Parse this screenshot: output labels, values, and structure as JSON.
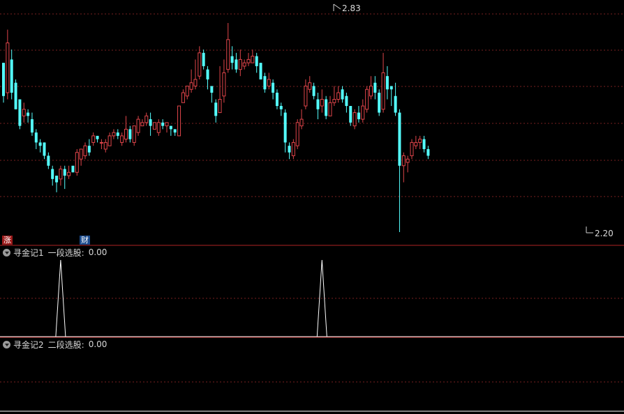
{
  "main_panel": {
    "high_label": "2.83",
    "low_label": "2.20",
    "badge_zhang": "涨",
    "badge_cai": "财",
    "up_color": "#e0454a",
    "down_color": "#54ffff"
  },
  "indicator1": {
    "name": "寻金记1",
    "line_name": "一段选股:",
    "value": "0.00"
  },
  "indicator2": {
    "name": "寻金记2",
    "line_name": "二段选股:",
    "value": "0.00"
  },
  "chart_data": [
    {
      "type": "candlestick",
      "y_min": 2.2,
      "y_max": 2.83,
      "candles": [
        [
          2.71,
          2.61,
          2.71,
          2.59
        ],
        [
          2.62,
          2.77,
          2.81,
          2.6
        ],
        [
          2.72,
          2.62,
          2.75,
          2.6
        ],
        [
          2.65,
          2.57,
          2.66,
          2.57
        ],
        [
          2.6,
          2.52,
          2.6,
          2.51
        ],
        [
          2.55,
          2.57,
          2.59,
          2.53
        ],
        [
          2.56,
          2.55,
          2.57,
          2.53
        ],
        [
          2.54,
          2.5,
          2.56,
          2.49
        ],
        [
          2.5,
          2.47,
          2.51,
          2.45
        ],
        [
          2.47,
          2.46,
          2.48,
          2.44
        ],
        [
          2.47,
          2.43,
          2.47,
          2.42
        ],
        [
          2.43,
          2.4,
          2.44,
          2.39
        ],
        [
          2.39,
          2.36,
          2.4,
          2.34
        ],
        [
          2.37,
          2.35,
          2.37,
          2.32
        ],
        [
          2.36,
          2.39,
          2.4,
          2.34
        ],
        [
          2.39,
          2.37,
          2.4,
          2.33
        ],
        [
          2.37,
          2.38,
          2.4,
          2.36
        ],
        [
          2.4,
          2.38,
          2.39,
          2.38
        ],
        [
          2.38,
          2.44,
          2.45,
          2.37
        ],
        [
          2.42,
          2.45,
          2.45,
          2.4
        ],
        [
          2.43,
          2.46,
          2.47,
          2.42
        ],
        [
          2.46,
          2.44,
          2.48,
          2.43
        ],
        [
          2.47,
          2.49,
          2.5,
          2.46
        ],
        [
          2.49,
          2.48,
          2.49,
          2.47
        ],
        [
          2.47,
          2.47,
          2.48,
          2.45
        ],
        [
          2.45,
          2.47,
          2.48,
          2.44
        ],
        [
          2.46,
          2.49,
          2.5,
          2.46
        ],
        [
          2.49,
          2.5,
          2.51,
          2.48
        ],
        [
          2.5,
          2.49,
          2.51,
          2.48
        ],
        [
          2.47,
          2.49,
          2.5,
          2.46
        ],
        [
          2.48,
          2.51,
          2.55,
          2.47
        ],
        [
          2.51,
          2.48,
          2.52,
          2.47
        ],
        [
          2.47,
          2.52,
          2.52,
          2.46
        ],
        [
          2.5,
          2.54,
          2.55,
          2.49
        ],
        [
          2.52,
          2.53,
          2.54,
          2.52
        ],
        [
          2.53,
          2.55,
          2.56,
          2.52
        ],
        [
          2.54,
          2.52,
          2.56,
          2.49
        ],
        [
          2.51,
          2.53,
          2.53,
          2.51
        ],
        [
          2.5,
          2.53,
          2.54,
          2.49
        ],
        [
          2.53,
          2.52,
          2.54,
          2.51
        ],
        [
          2.52,
          2.53,
          2.53,
          2.5
        ],
        [
          2.52,
          2.51,
          2.52,
          2.49
        ],
        [
          2.51,
          2.5,
          2.51,
          2.49
        ],
        [
          2.49,
          2.58,
          2.58,
          2.49
        ],
        [
          2.59,
          2.62,
          2.63,
          2.59
        ],
        [
          2.61,
          2.64,
          2.64,
          2.6
        ],
        [
          2.63,
          2.65,
          2.69,
          2.62
        ],
        [
          2.64,
          2.66,
          2.72,
          2.63
        ],
        [
          2.67,
          2.74,
          2.76,
          2.66
        ],
        [
          2.74,
          2.7,
          2.75,
          2.69
        ],
        [
          2.69,
          2.66,
          2.7,
          2.63
        ],
        [
          2.64,
          2.62,
          2.64,
          2.59
        ],
        [
          2.59,
          2.55,
          2.6,
          2.53
        ],
        [
          2.56,
          2.6,
          2.7,
          2.56
        ],
        [
          2.61,
          2.68,
          2.72,
          2.59
        ],
        [
          2.69,
          2.78,
          2.83,
          2.68
        ],
        [
          2.73,
          2.71,
          2.76,
          2.69
        ],
        [
          2.72,
          2.69,
          2.74,
          2.68
        ],
        [
          2.69,
          2.72,
          2.75,
          2.67
        ],
        [
          2.7,
          2.71,
          2.72,
          2.69
        ],
        [
          2.71,
          2.72,
          2.74,
          2.7
        ],
        [
          2.71,
          2.73,
          2.75,
          2.71
        ],
        [
          2.73,
          2.7,
          2.74,
          2.68
        ],
        [
          2.71,
          2.66,
          2.71,
          2.66
        ],
        [
          2.67,
          2.63,
          2.68,
          2.62
        ],
        [
          2.64,
          2.66,
          2.68,
          2.63
        ],
        [
          2.65,
          2.62,
          2.66,
          2.6
        ],
        [
          2.62,
          2.58,
          2.63,
          2.57
        ],
        [
          2.58,
          2.57,
          2.59,
          2.55
        ],
        [
          2.56,
          2.47,
          2.57,
          2.44
        ],
        [
          2.46,
          2.44,
          2.47,
          2.42
        ],
        [
          2.43,
          2.47,
          2.48,
          2.42
        ],
        [
          2.46,
          2.53,
          2.54,
          2.45
        ],
        [
          2.52,
          2.54,
          2.57,
          2.51
        ],
        [
          2.58,
          2.64,
          2.66,
          2.57
        ],
        [
          2.63,
          2.65,
          2.67,
          2.62
        ],
        [
          2.64,
          2.61,
          2.65,
          2.6
        ],
        [
          2.6,
          2.57,
          2.62,
          2.54
        ],
        [
          2.58,
          2.6,
          2.63,
          2.56
        ],
        [
          2.6,
          2.55,
          2.61,
          2.54
        ],
        [
          2.55,
          2.59,
          2.61,
          2.55
        ],
        [
          2.59,
          2.6,
          2.64,
          2.58
        ],
        [
          2.6,
          2.62,
          2.64,
          2.59
        ],
        [
          2.63,
          2.6,
          2.64,
          2.59
        ],
        [
          2.61,
          2.58,
          2.62,
          2.56
        ],
        [
          2.58,
          2.53,
          2.58,
          2.52
        ],
        [
          2.52,
          2.56,
          2.57,
          2.51
        ],
        [
          2.56,
          2.54,
          2.58,
          2.53
        ],
        [
          2.54,
          2.58,
          2.6,
          2.53
        ],
        [
          2.57,
          2.63,
          2.64,
          2.56
        ],
        [
          2.61,
          2.64,
          2.67,
          2.6
        ],
        [
          2.65,
          2.62,
          2.67,
          2.6
        ],
        [
          2.62,
          2.56,
          2.63,
          2.55
        ],
        [
          2.57,
          2.68,
          2.74,
          2.56
        ],
        [
          2.67,
          2.63,
          2.7,
          2.6
        ],
        [
          2.64,
          2.63,
          2.64,
          2.58
        ],
        [
          2.61,
          2.56,
          2.65,
          2.55
        ],
        [
          2.56,
          2.4,
          2.57,
          2.2
        ],
        [
          2.4,
          2.43,
          2.44,
          2.35
        ],
        [
          2.41,
          2.42,
          2.43,
          2.38
        ],
        [
          2.43,
          2.47,
          2.48,
          2.42
        ],
        [
          2.46,
          2.47,
          2.49,
          2.45
        ],
        [
          2.47,
          2.48,
          2.49,
          2.45
        ],
        [
          2.48,
          2.45,
          2.49,
          2.44
        ],
        [
          2.45,
          2.43,
          2.46,
          2.42
        ]
      ]
    },
    {
      "type": "line",
      "title": "一段选股",
      "value": 0.0,
      "ylim": [
        0,
        1
      ],
      "spike_indices": [
        14,
        78
      ]
    },
    {
      "type": "line",
      "title": "二段选股",
      "value": 0.0,
      "ylim": [
        0,
        1
      ],
      "spike_indices": []
    }
  ]
}
